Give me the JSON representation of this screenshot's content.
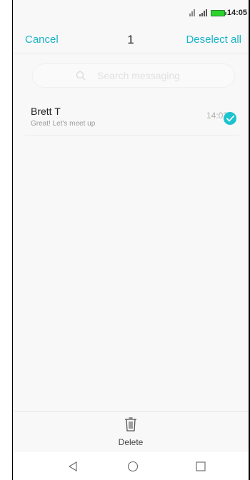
{
  "status_bar": {
    "time": "14:05",
    "icons": [
      "signal-1-icon",
      "signal-2-icon",
      "battery-icon"
    ],
    "battery_color": "#2bd32b"
  },
  "header": {
    "cancel_label": "Cancel",
    "selected_count": "1",
    "deselect_label": "Deselect all",
    "accent_color": "#1ab3c6"
  },
  "search": {
    "placeholder": "Search messaging",
    "value": ""
  },
  "conversations": [
    {
      "name": "Brett T",
      "preview": "Great! Let's meet up",
      "time": "14:02",
      "selected": true
    }
  ],
  "bottom_bar": {
    "delete_label": "Delete"
  },
  "nav_bar": {
    "icons": [
      "back-icon",
      "home-icon",
      "recents-icon"
    ]
  }
}
